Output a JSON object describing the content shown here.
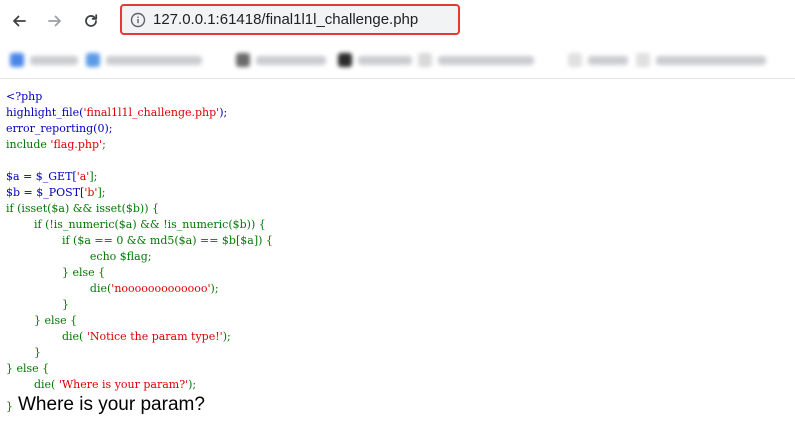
{
  "browser": {
    "back_icon": "arrow-left-icon",
    "forward_icon": "arrow-right-icon",
    "reload_icon": "reload-icon",
    "site_info_icon": "site-info-icon",
    "address": "127.0.0.1:61418/final1l1l_challenge.php",
    "highlight_color": "#e53935"
  },
  "code": {
    "l1": "<?php",
    "l2a": "highlight_file(",
    "l2b": "'final1l1l_challenge.php'",
    "l2c": ");",
    "l3a": "error_reporting(0);",
    "l4a": "include ",
    "l4b": "'flag.php'",
    "l4c": ";",
    "l6a": "$a = $_GET[",
    "l6b": "'a'",
    "l6c": "];",
    "l7a": "$b = $_POST[",
    "l7b": "'b'",
    "l7c": "];",
    "l8a": "if (isset($a) && isset($b)) {",
    "l9a": "if (!is_numeric($a) && !is_numeric($b)) {",
    "l10a": "if ($a == 0 && md5($a) == $b[$a]) {",
    "l11a": "echo $flag;",
    "l12a": "} else {",
    "l13a": "die(",
    "l13b": "'nooooooooooooo'",
    "l13c": ");",
    "l14a": "}",
    "l15a": "} else {",
    "l16a": "die( ",
    "l16b": "'Notice the param type!'",
    "l16c": ");",
    "l17a": "}",
    "l18a": "} else {",
    "l19a": "die( ",
    "l19b": "'Where is your param?'",
    "l19c": ");",
    "l20a": "}"
  },
  "output": {
    "text": "Where is your param?"
  }
}
